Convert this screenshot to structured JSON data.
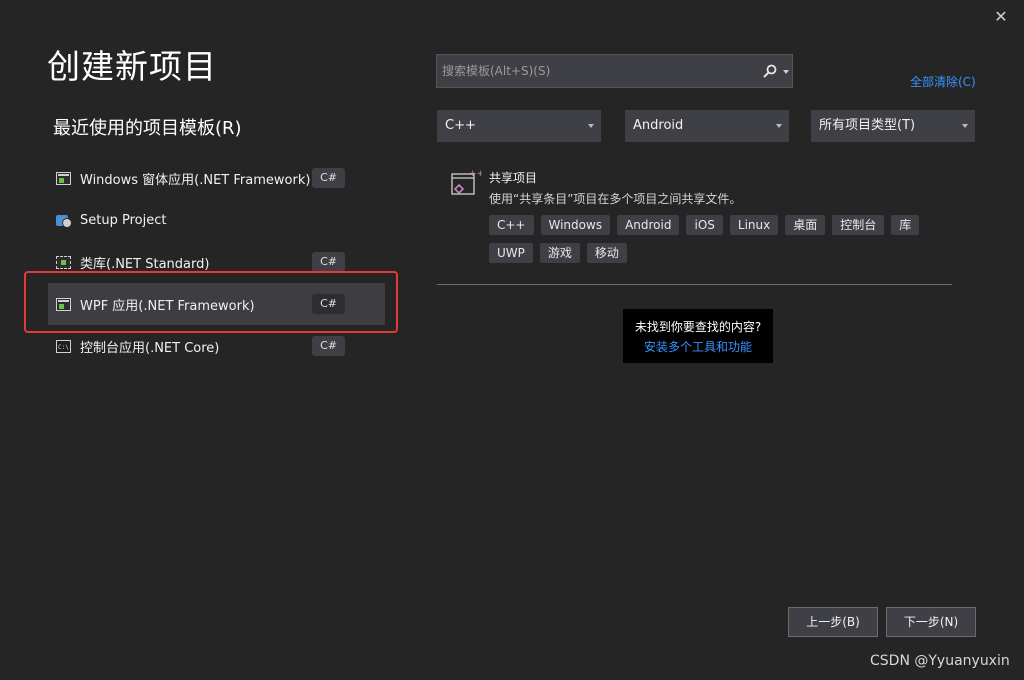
{
  "window": {
    "close_glyph": "✕",
    "title": "创建新项目"
  },
  "recent": {
    "heading": "最近使用的项目模板(R)",
    "items": [
      {
        "label": "Windows 窗体应用(.NET Framework)",
        "lang": "C#",
        "icon": "winforms-icon"
      },
      {
        "label": "Setup Project",
        "lang": "",
        "icon": "setup-project-icon"
      },
      {
        "label": "类库(.NET Standard)",
        "lang": "C#",
        "icon": "class-library-icon"
      },
      {
        "label": "WPF 应用(.NET Framework)",
        "lang": "C#",
        "icon": "wpf-icon",
        "selected": true
      },
      {
        "label": "控制台应用(.NET Core)",
        "lang": "C#",
        "icon": "console-icon"
      }
    ]
  },
  "search": {
    "placeholder": "搜索模板(Alt+S)(S)",
    "icon": "search-icon"
  },
  "clear_all": "全部清除(C)",
  "filters": {
    "language": "C++",
    "platform": "Android",
    "project_type": "所有项目类型(T)"
  },
  "template": {
    "icon": "shared-project-icon",
    "title": "共享项目",
    "description": "使用“共享条目”项目在多个项目之间共享文件。",
    "tags": [
      "C++",
      "Windows",
      "Android",
      "iOS",
      "Linux",
      "桌面",
      "控制台",
      "库",
      "UWP",
      "游戏",
      "移动"
    ]
  },
  "not_found": {
    "question": "未找到你要查找的内容?",
    "link": "安装多个工具和功能"
  },
  "buttons": {
    "back": "上一步(B)",
    "next": "下一步(N)"
  },
  "watermark": "CSDN @Yyuanyuxin",
  "colors": {
    "background": "#252526",
    "selected_row": "#3e3e42",
    "accent_link": "#3794ff",
    "highlight_border": "#e53935"
  }
}
